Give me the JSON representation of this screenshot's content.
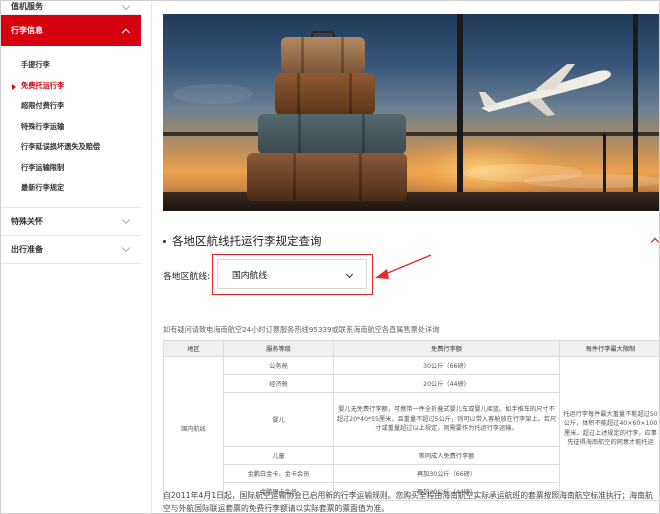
{
  "sidebar": {
    "sections": [
      {
        "label": "值机服务"
      },
      {
        "label": "行李信息"
      },
      {
        "label": "特殊关怀"
      },
      {
        "label": "出行准备"
      }
    ],
    "items": [
      {
        "label": "手提行李"
      },
      {
        "label": "免费托运行李"
      },
      {
        "label": "超限付费行李"
      },
      {
        "label": "特殊行李运输"
      },
      {
        "label": "行李延误损坏遗失及赔偿"
      },
      {
        "label": "行李运输限制"
      },
      {
        "label": "最新行李规定"
      }
    ]
  },
  "main": {
    "title": "各地区航线托运行李规定查询",
    "route_label": "各地区航线:",
    "route_selected": "国内航线",
    "note": "如有疑问请致电海南航空24小时订票服务热线95339或联系海南航空各直属售票处详询",
    "table": {
      "headers": [
        "地区",
        "服务等级",
        "免费行李额",
        "每件行李最大限制"
      ],
      "region": "国内航线",
      "rows": [
        {
          "level": "公务舱",
          "allowance": "30公斤（66磅）"
        },
        {
          "level": "经济舱",
          "allowance": "20公斤（44磅）"
        },
        {
          "level": "婴儿",
          "allowance": "婴儿无免费行李额，可携带一件全折叠式婴儿车或婴儿摇篮。如手推车的尺寸不超过20*40*55厘米，且重量不超过5公斤，则可以带入客舱放在行李架上。若尺寸或重量超过以上规定，则需要作为托运行李运输。"
        },
        {
          "level": "儿童",
          "allowance": "等同成人免费行李额"
        },
        {
          "level": "金鹏白金卡、金卡会员",
          "allowance": "再加30公斤（66磅）"
        },
        {
          "level": "金鹏银卡会员",
          "allowance": "再加20公斤（44磅）"
        }
      ],
      "max_limit": "托运行李每件最大重量不能超过50公斤，体积不能超过40×60×100厘米。超过上述规定的行李，应事先征得海南航空的同意才能托运"
    },
    "footer": "自2011年4月1日起，国际航空运输协会已启用新的行李运输规则。您购买全程由海南航空实际承运航班的套票按照海南航空标准执行；海南航空与外航国际联运套票的免费行李额请以实际套票的票面值为准。"
  },
  "colors": {
    "accent": "#d7000f",
    "highlight": "#e5282d"
  }
}
